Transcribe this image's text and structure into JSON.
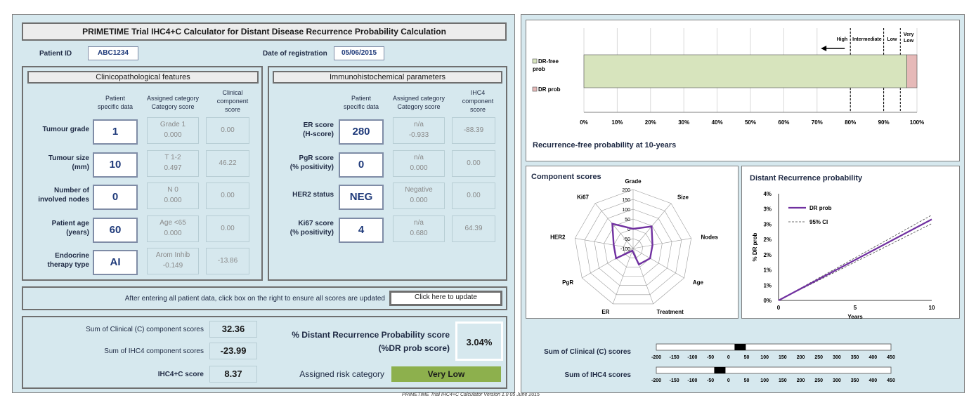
{
  "title": "PRIMETIME Trial IHC4+C Calculator for Distant Disease Recurrence Probability Calculation",
  "patient": {
    "id_label": "Patient ID",
    "id_value": "ABC1234",
    "date_label": "Date of registration",
    "date_value": "05/06/2015"
  },
  "clinical": {
    "header": "Clinicopathological features",
    "col_patient": [
      "Patient",
      "specific data"
    ],
    "col_assigned": [
      "Assigned category",
      "Category score"
    ],
    "col_component": [
      "Clinical",
      "component",
      "score"
    ],
    "rows": [
      {
        "label": [
          "Tumour grade"
        ],
        "value": "1",
        "category": "Grade 1",
        "cat_score": "0.000",
        "component": "0.00"
      },
      {
        "label": [
          "Tumour size",
          "(mm)"
        ],
        "value": "10",
        "category": "T 1-2",
        "cat_score": "0.497",
        "component": "46.22"
      },
      {
        "label": [
          "Number of",
          "involved nodes"
        ],
        "value": "0",
        "category": "N 0",
        "cat_score": "0.000",
        "component": "0.00"
      },
      {
        "label": [
          "Patient age",
          "(years)"
        ],
        "value": "60",
        "category": "Age <65",
        "cat_score": "0.000",
        "component": "0.00"
      },
      {
        "label": [
          "Endocrine",
          "therapy type"
        ],
        "value": "AI",
        "category": "Arom Inhib",
        "cat_score": "-0.149",
        "component": "-13.86"
      }
    ]
  },
  "ihc": {
    "header": "Immunohistochemical parameters",
    "col_patient": [
      "Patient",
      "specific data"
    ],
    "col_assigned": [
      "Assigned category",
      "Category score"
    ],
    "col_component": [
      "IHC4",
      "component",
      "score"
    ],
    "rows": [
      {
        "label": [
          "ER score",
          "(H-score)"
        ],
        "value": "280",
        "category": "n/a",
        "cat_score": "-0.933",
        "component": "-88.39"
      },
      {
        "label": [
          "PgR score",
          "(% positivity)"
        ],
        "value": "0",
        "category": "n/a",
        "cat_score": "0.000",
        "component": "0.00"
      },
      {
        "label": [
          "HER2 status"
        ],
        "value": "NEG",
        "category": "Negative",
        "cat_score": "0.000",
        "component": "0.00"
      },
      {
        "label": [
          "Ki67 score",
          "(% positivity)"
        ],
        "value": "4",
        "category": "n/a",
        "cat_score": "0.680",
        "component": "64.39"
      }
    ]
  },
  "update": {
    "instruction": "After entering all patient data, click box on the right to ensure all scores are updated",
    "button": "Click here to update"
  },
  "summary": {
    "clinical_label": "Sum of Clinical (C) component scores",
    "clinical_value": "32.36",
    "ihc4_label": "Sum of IHC4 component scores",
    "ihc4_value": "-23.99",
    "ihc4c_label": "IHC4+C score",
    "ihc4c_value": "8.37",
    "dr_label_1": "% Distant Recurrence Probability score",
    "dr_label_2": "(%DR prob score)",
    "dr_value": "3.04%",
    "risk_label": "Assigned risk category",
    "risk_value": "Very Low",
    "risk_color": "#8db04d"
  },
  "footer": "PRIMETIME Trial IHC4+C Calculator Version 1.0 05 June 2015",
  "bar_chart": {
    "title": "Recurrence-free probability at 10-years",
    "legend": [
      "DR-free prob",
      "DR prob"
    ],
    "colors": [
      "#d7e4bd",
      "#e6b9b8"
    ],
    "ticks": [
      "0%",
      "10%",
      "20%",
      "30%",
      "40%",
      "50%",
      "60%",
      "70%",
      "80%",
      "90%",
      "100%"
    ],
    "zones": [
      "High",
      "Intermediate",
      "Low",
      "Very Low"
    ],
    "zone_bounds": [
      80,
      90,
      95
    ]
  },
  "radar": {
    "title": "Component scores",
    "axes": [
      "Grade",
      "Size",
      "Nodes",
      "Age",
      "Treatment",
      "ER",
      "PgR",
      "HER2",
      "Ki67"
    ],
    "ticks": [
      "200",
      "150",
      "100",
      "50",
      "0",
      "-50",
      "-100"
    ]
  },
  "line_chart": {
    "title": "Distant Recurrence probability",
    "ylabel": "% DR prob",
    "xlabel": "Years",
    "yticks": [
      "4%",
      "3%",
      "3%",
      "2%",
      "2%",
      "1%",
      "1%",
      "0%"
    ],
    "xticks": [
      "0",
      "5",
      "10"
    ],
    "legend": [
      "DR prob",
      "95% CI"
    ],
    "line_color": "#7030a0"
  },
  "scales": {
    "clinical_label": "Sum of Clinical (C) scores",
    "ihc4_label": "Sum of IHC4 scores",
    "ticks": [
      "-200",
      "-150",
      "-100",
      "-50",
      "0",
      "50",
      "100",
      "150",
      "200",
      "250",
      "300",
      "350",
      "400",
      "450"
    ]
  },
  "chart_data": [
    {
      "type": "bar",
      "title": "Recurrence-free probability at 10-years",
      "categories": [
        "10-years"
      ],
      "series": [
        {
          "name": "DR-free prob",
          "values": [
            96.96
          ]
        },
        {
          "name": "DR prob",
          "values": [
            3.04
          ]
        }
      ],
      "xlim": [
        0,
        100
      ],
      "stacked": true,
      "orientation": "horizontal"
    },
    {
      "type": "line",
      "title": "Distant Recurrence probability",
      "xlabel": "Years",
      "ylabel": "% DR prob",
      "x": [
        0,
        5,
        10
      ],
      "series": [
        {
          "name": "DR prob",
          "values": [
            0,
            1.52,
            3.04
          ]
        },
        {
          "name": "95% CI",
          "values": [
            0,
            1.6,
            3.2
          ]
        },
        {
          "name": "95% CI",
          "values": [
            0,
            1.44,
            2.88
          ]
        }
      ],
      "xlim": [
        0,
        10
      ],
      "ylim": [
        0,
        4
      ]
    },
    {
      "type": "radar",
      "title": "Component scores",
      "categories": [
        "Grade",
        "Size",
        "Nodes",
        "Age",
        "Treatment",
        "ER",
        "PgR",
        "HER2",
        "Ki67"
      ],
      "values": [
        0,
        46.22,
        0,
        0,
        -13.86,
        -88.39,
        0,
        0,
        64.39
      ],
      "range": [
        -100,
        200
      ]
    },
    {
      "type": "bar",
      "title": "Sum of Clinical (C) scores",
      "values": [
        32.36
      ],
      "xlim": [
        -200,
        450
      ]
    },
    {
      "type": "bar",
      "title": "Sum of IHC4 scores",
      "values": [
        -23.99
      ],
      "xlim": [
        -200,
        450
      ]
    }
  ]
}
